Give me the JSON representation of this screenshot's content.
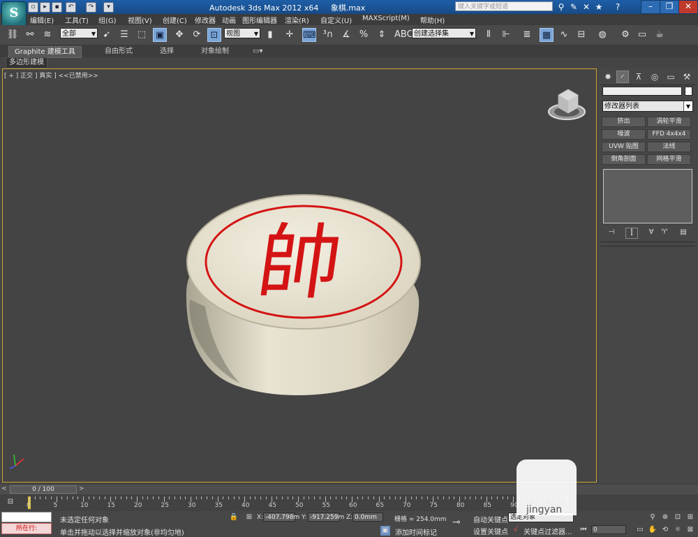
{
  "titlebar": {
    "app_title": "Autodesk 3ds Max  2012 x64",
    "file_name": "象棋.max",
    "search_placeholder": "键入关键字或短语",
    "logo_letter": "S",
    "buttons": [
      "minimize",
      "restore",
      "close"
    ]
  },
  "menubar": {
    "items": [
      "编辑(E)",
      "工具(T)",
      "组(G)",
      "视图(V)",
      "创建(C)",
      "修改器",
      "动画",
      "图形编辑器",
      "渲染(R)",
      "自定义(U)",
      "MAXScript(M)",
      "帮助(H)"
    ]
  },
  "toolbar": {
    "selection_filter": "全部",
    "ref_coord": "视图",
    "named_selection": "创建选择集"
  },
  "ribbon": {
    "tabs": [
      "Graphite 建模工具",
      "自由形式",
      "选择",
      "对象绘制"
    ],
    "subtab": "多边形建模"
  },
  "viewport": {
    "label": "[ + ] 正交 ] 真实 ] <<已禁用>>",
    "piece_character": "帥",
    "piece_color": "#e9e4d3",
    "piece_text_color": "#d41414"
  },
  "command_panel": {
    "modifier_list": "修改器列表",
    "modifier_buttons": [
      "挤出",
      "涡轮平滑",
      "噪波",
      "FFD 4x4x4",
      "UVW 贴图",
      "法线",
      "倒角剖面",
      "网格平滑"
    ]
  },
  "timeline": {
    "slider_label": "0 / 100",
    "ticks": [
      "0",
      "5",
      "10",
      "15",
      "20",
      "25",
      "30",
      "35",
      "40",
      "45",
      "50",
      "55",
      "60",
      "65",
      "70",
      "75",
      "80",
      "85",
      "90"
    ]
  },
  "statusbar": {
    "script_label": "所在行:",
    "selection_status": "未选定任何对象",
    "prompt": "单击并拖动以选择并缩放对象(非均匀地)",
    "x_label": "X:",
    "x_value": "-407.798m",
    "y_label": "Y:",
    "y_value": "-917.259m",
    "z_label": "Z:",
    "z_value": "0.0mm",
    "grid": "栅格 = 254.0mm",
    "add_time_tag": "添加时间标记",
    "auto_key": "自动关键点",
    "set_key": "设置关键点",
    "key_mode": "选定对象",
    "key_filters": "关键点过滤器...",
    "frame": "0"
  },
  "watermark": "jingyan"
}
